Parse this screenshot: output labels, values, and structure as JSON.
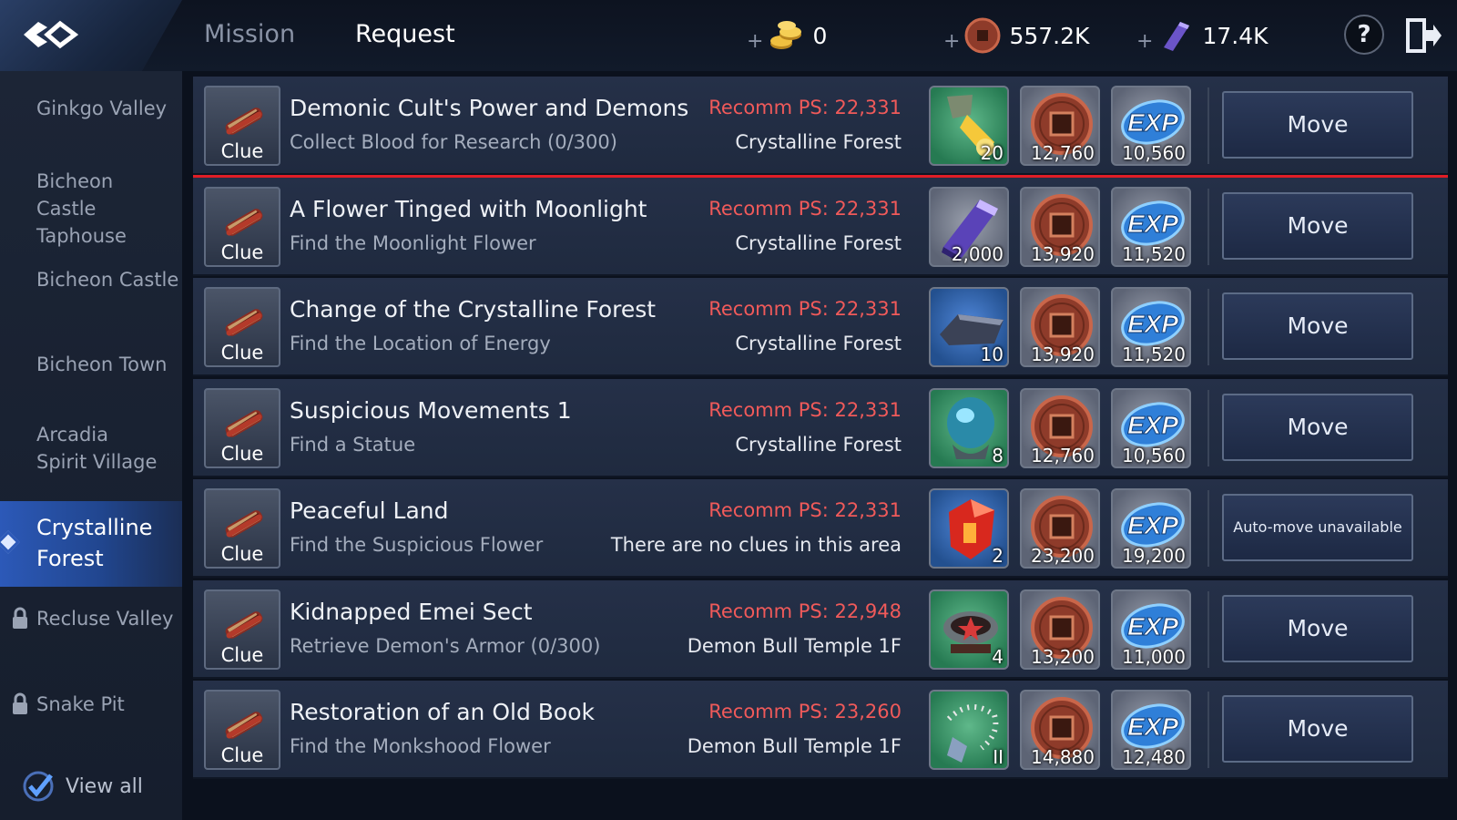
{
  "header": {
    "tabs": [
      {
        "label": "Mission"
      },
      {
        "label": "Request"
      }
    ],
    "currencies": [
      {
        "icon": "gold-coins-icon",
        "value": "0"
      },
      {
        "icon": "copper-coin-icon",
        "value": "557.2K"
      },
      {
        "icon": "purple-crystal-icon",
        "value": "17.4K"
      }
    ],
    "plus": "+",
    "help": "?"
  },
  "sidebar": {
    "items": [
      {
        "label": "Ginkgo Valley",
        "locked": false,
        "active": false
      },
      {
        "label": "Bicheon Castle Taphouse",
        "locked": false,
        "active": false
      },
      {
        "label": "Bicheon Castle",
        "locked": false,
        "active": false
      },
      {
        "label": "Bicheon Town",
        "locked": false,
        "active": false
      },
      {
        "label": "Arcadia Spirit Village",
        "locked": false,
        "active": false
      },
      {
        "label": "Crystalline Forest",
        "locked": false,
        "active": true
      },
      {
        "label": "Recluse Valley",
        "locked": true,
        "active": false
      },
      {
        "label": "Snake Pit",
        "locked": true,
        "active": false
      }
    ],
    "view_all": "View all",
    "view_all_checked": true
  },
  "requests": [
    {
      "badge": "Clue",
      "title": "Demonic Cult's Power and Demons",
      "subtitle": "Collect Blood for Research (0/300)",
      "recomm_ps": "Recomm PS: 22,331",
      "area": "Crystalline Forest",
      "item_icon": "blood-vial-icon",
      "item_qty": "20",
      "coin_qty": "12,760",
      "exp_qty": "10,560",
      "button": "Move"
    },
    {
      "badge": "Clue",
      "title": "A Flower Tinged with Moonlight",
      "subtitle": "Find the Moonlight Flower",
      "recomm_ps": "Recomm PS: 22,331",
      "area": "Crystalline Forest",
      "item_icon": "purple-crystal-icon",
      "item_qty": "2,000",
      "coin_qty": "13,920",
      "exp_qty": "11,520",
      "button": "Move"
    },
    {
      "badge": "Clue",
      "title": "Change of the Crystalline Forest",
      "subtitle": "Find the Location of Energy",
      "recomm_ps": "Recomm PS: 22,331",
      "area": "Crystalline Forest",
      "item_icon": "ore-ingot-icon",
      "item_qty": "10",
      "coin_qty": "13,920",
      "exp_qty": "11,520",
      "button": "Move"
    },
    {
      "badge": "Clue",
      "title": "Suspicious Movements 1",
      "subtitle": "Find a Statue",
      "recomm_ps": "Recomm PS: 22,331",
      "area": "Crystalline Forest",
      "item_icon": "crystal-orb-icon",
      "item_qty": "8",
      "coin_qty": "12,760",
      "exp_qty": "10,560",
      "button": "Move"
    },
    {
      "badge": "Clue",
      "title": "Peaceful Land",
      "subtitle": "Find the Suspicious Flower",
      "recomm_ps": "Recomm PS: 22,331",
      "area": "There are no clues in this area",
      "item_icon": "red-gem-icon",
      "item_qty": "2",
      "coin_qty": "23,200",
      "exp_qty": "19,200",
      "button": "Auto-move unavailable"
    },
    {
      "badge": "Clue",
      "title": "Kidnapped Emei Sect",
      "subtitle": "Retrieve Demon's Armor (0/300)",
      "recomm_ps": "Recomm PS: 22,948",
      "area": "Demon Bull Temple 1F",
      "item_icon": "incense-bowl-icon",
      "item_qty": "4",
      "coin_qty": "13,200",
      "exp_qty": "11,000",
      "button": "Move"
    },
    {
      "badge": "Clue",
      "title": "Restoration of an Old Book",
      "subtitle": "Find the Monkshood Flower",
      "recomm_ps": "Recomm PS: 23,260",
      "area": "Demon Bull Temple 1F",
      "item_icon": "prayer-beads-icon",
      "item_qty": "II",
      "coin_qty": "14,880",
      "exp_qty": "12,480",
      "button": "Move"
    }
  ],
  "exp_label": "EXP",
  "colors": {
    "selected_outline": "#e01e26",
    "recomm_ps": "#f05a5a",
    "active_side": "#2c59b8"
  }
}
